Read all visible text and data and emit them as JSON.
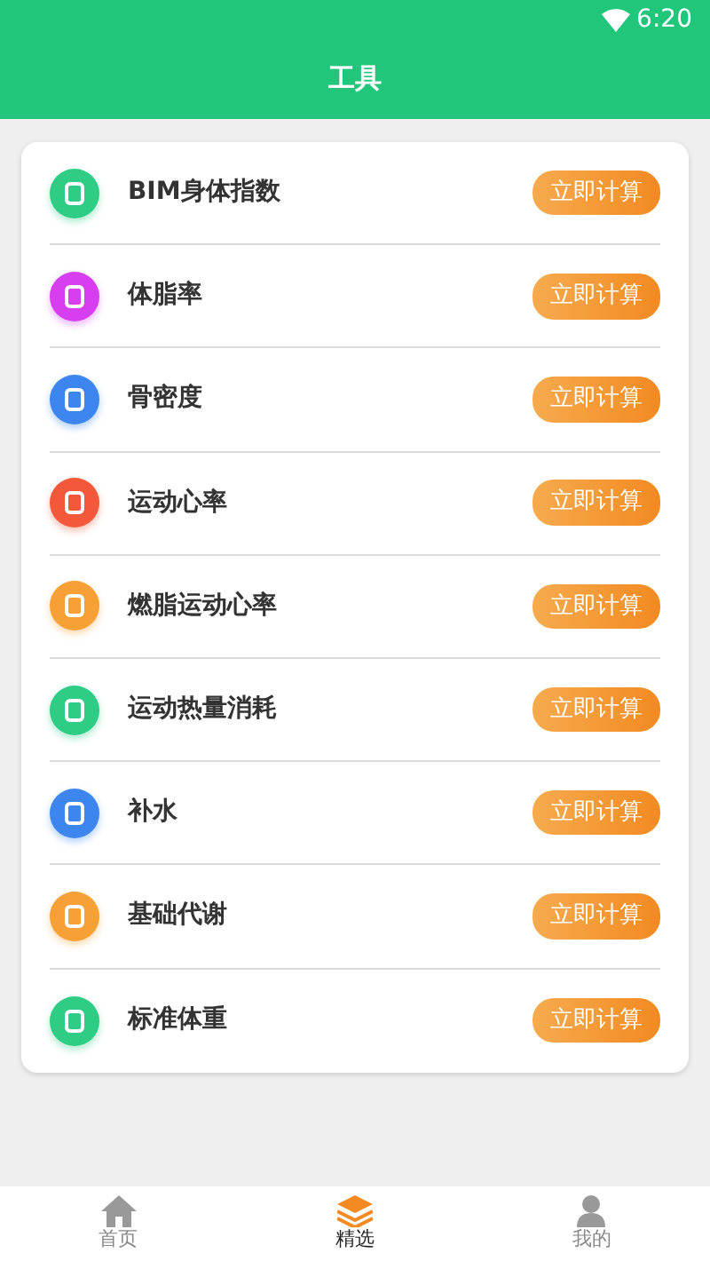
{
  "status_bar": {
    "time": "6:20"
  },
  "header": {
    "title": "工具"
  },
  "tools": [
    {
      "name": "BIM身体指数",
      "color": "#2ecc85",
      "button": "立即计算"
    },
    {
      "name": "体脂率",
      "color": "#d63ef0",
      "button": "立即计算"
    },
    {
      "name": "骨密度",
      "color": "#3d86f0",
      "button": "立即计算"
    },
    {
      "name": "运动心率",
      "color": "#f4583a",
      "button": "立即计算"
    },
    {
      "name": "燃脂运动心率",
      "color": "#f6a035",
      "button": "立即计算"
    },
    {
      "name": "运动热量消耗",
      "color": "#2ecc85",
      "button": "立即计算"
    },
    {
      "name": "补水",
      "color": "#3d86f0",
      "button": "立即计算"
    },
    {
      "name": "基础代谢",
      "color": "#f6a035",
      "button": "立即计算"
    },
    {
      "name": "标准体重",
      "color": "#2ecc85",
      "button": "立即计算"
    }
  ],
  "tabs": [
    {
      "label": "首页",
      "kind": "home",
      "selected": false
    },
    {
      "label": "精选",
      "kind": "layers",
      "selected": true
    },
    {
      "label": "我的",
      "kind": "person",
      "selected": false
    }
  ]
}
